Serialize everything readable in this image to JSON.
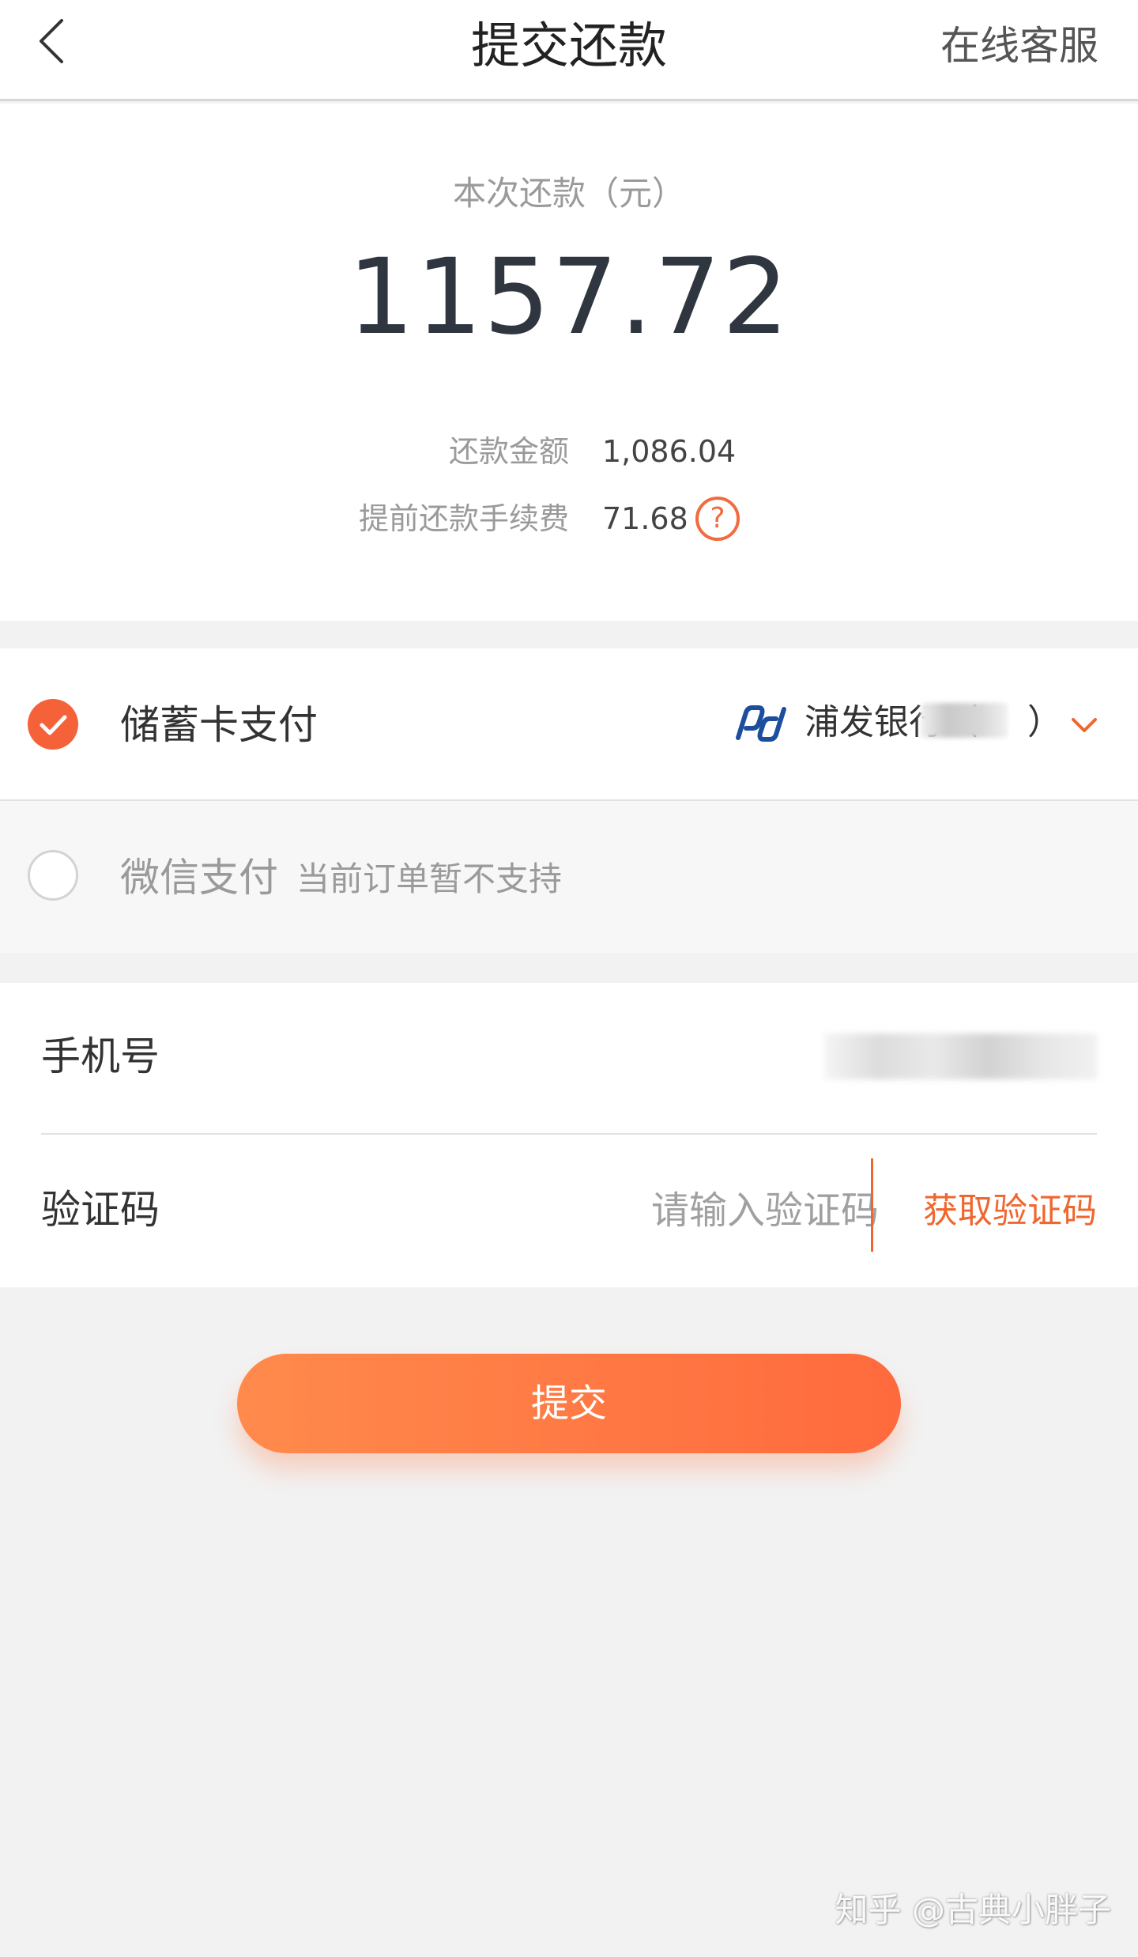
{
  "header": {
    "title": "提交还款",
    "service_label": "在线客服"
  },
  "amount": {
    "label": "本次还款（元）",
    "value": "1157.72",
    "details": [
      {
        "label": "还款金额",
        "value": "1,086.04"
      },
      {
        "label": "提前还款手续费",
        "value": "71.68"
      }
    ],
    "help_glyph": "?"
  },
  "payment": {
    "debit": {
      "label": "储蓄卡支付",
      "selected": true,
      "bank_name": "浦发银行（",
      "bank_paren_close": "）"
    },
    "wechat": {
      "label": "微信支付",
      "note": "当前订单暂不支持",
      "selected": false
    }
  },
  "form": {
    "phone_label": "手机号",
    "code_label": "验证码",
    "code_placeholder": "请输入验证码",
    "get_code_label": "获取验证码"
  },
  "submit_label": "提交",
  "watermark": "知乎 @古典小胖子",
  "colors": {
    "accent": "#f0662f",
    "button_start": "#ff8a4c",
    "button_end": "#ff6a3d",
    "bank_brand": "#1d4e9e"
  }
}
